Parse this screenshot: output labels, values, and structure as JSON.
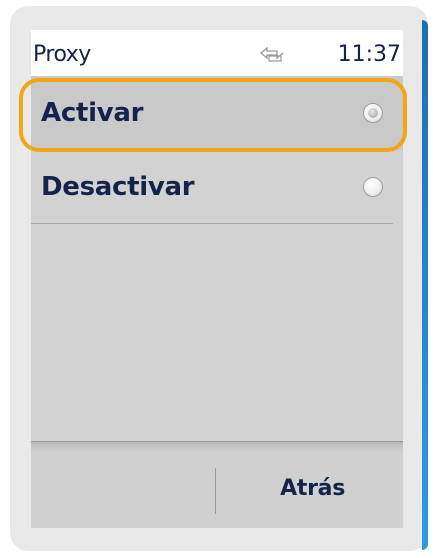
{
  "header": {
    "title": "Proxy",
    "time": "11:37",
    "network_icon": "network-data-icon"
  },
  "options": [
    {
      "label": "Activar",
      "selected": true
    },
    {
      "label": "Desactivar",
      "selected": false
    }
  ],
  "softkeys": {
    "left": "",
    "right": "Atrás"
  },
  "colors": {
    "focus": "#f2a516",
    "text": "#14234a",
    "accent": "#1d6fb2"
  }
}
